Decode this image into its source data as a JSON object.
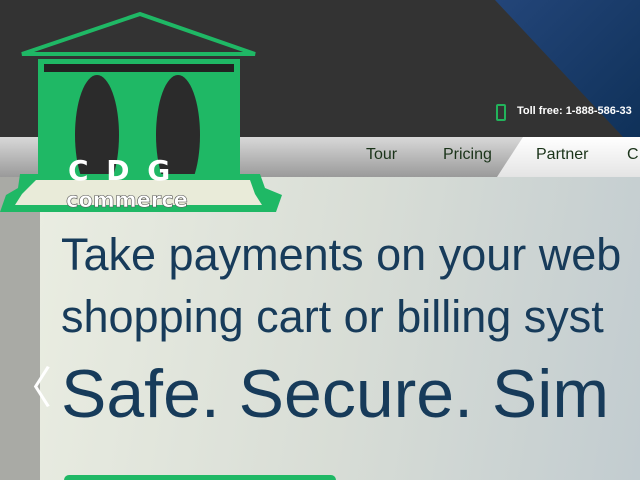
{
  "brand": {
    "name": "CDG commerce",
    "letters": "C D G",
    "sub": "commerce",
    "color": "#1fb865"
  },
  "header": {
    "toll_free": "Toll free: 1-888-586-33",
    "phone_icon": "mobile-phone-icon"
  },
  "nav": {
    "items": [
      {
        "label": "Tour"
      },
      {
        "label": "Pricing"
      },
      {
        "label": "Partner",
        "active": true
      },
      {
        "label": "C"
      }
    ]
  },
  "hero": {
    "line1": "Take payments on your web",
    "line2": "shopping cart or billing syst",
    "line3": "Safe. Secure. Sim",
    "prev_icon": "chevron-left-icon",
    "text_color": "#173b5a"
  }
}
